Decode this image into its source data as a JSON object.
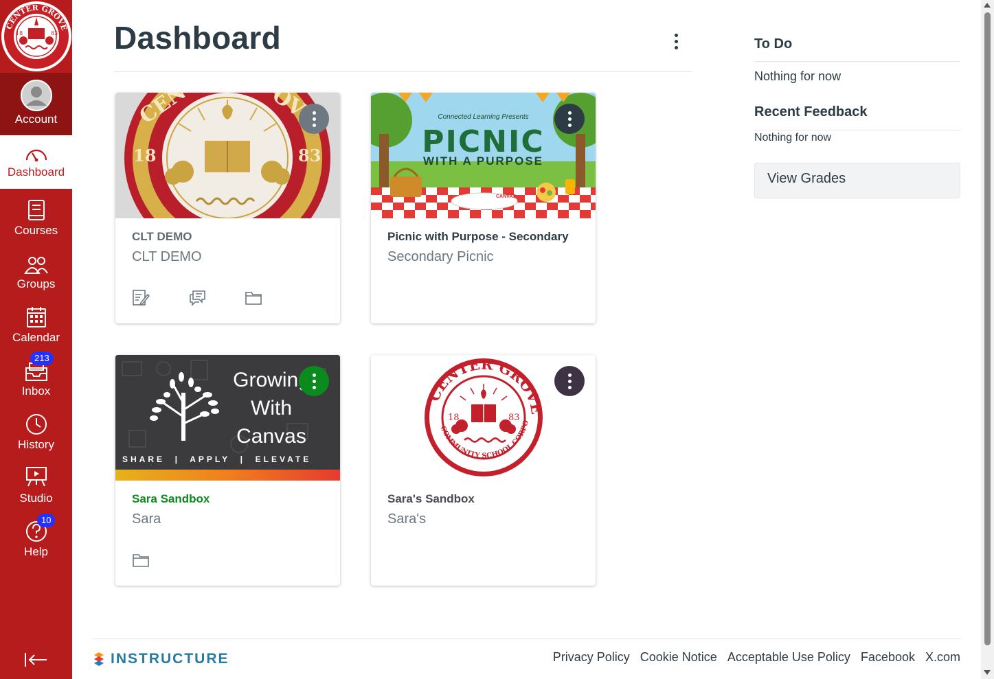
{
  "nav": {
    "logo_alt": "Center Grove Community School Corporation 1883",
    "items": [
      {
        "label": "Account",
        "icon": "user-avatar-icon"
      },
      {
        "label": "Dashboard",
        "icon": "dashboard-gauge-icon"
      },
      {
        "label": "Courses",
        "icon": "courses-book-icon"
      },
      {
        "label": "Groups",
        "icon": "groups-people-icon"
      },
      {
        "label": "Calendar",
        "icon": "calendar-icon"
      },
      {
        "label": "Inbox",
        "icon": "inbox-tray-icon",
        "badge": "213"
      },
      {
        "label": "History",
        "icon": "history-clock-icon"
      },
      {
        "label": "Studio",
        "icon": "studio-board-icon"
      },
      {
        "label": "Help",
        "icon": "help-question-icon",
        "badge": "10"
      }
    ],
    "collapse_icon": "collapse-arrow-icon"
  },
  "header": {
    "title": "Dashboard",
    "options_icon": "kebab-menu-icon"
  },
  "cards": [
    {
      "title": "CLT DEMO",
      "subtitle": "CLT DEMO",
      "title_color": "#5f6a72",
      "kebab_color": "#6d7883",
      "hero": "seal-gold",
      "icons": [
        "assignments-icon",
        "discussions-icon",
        "files-folder-icon"
      ]
    },
    {
      "title": "Picnic with Purpose - Secondary",
      "subtitle": "Secondary Picnic",
      "title_color": "#2d3b45",
      "kebab_color": "#2d3b45",
      "hero": "picnic",
      "hero_text": {
        "small": "Connected Learning Presents",
        "big": "PICNIC",
        "sub": "WITH A PURPOSE",
        "tag": "CANVAS"
      },
      "icons": []
    },
    {
      "title": "Sara Sandbox",
      "subtitle": "Sara",
      "title_color": "#0b8a1d",
      "kebab_color": "#0b8a1d",
      "hero": "growing",
      "hero_text": {
        "line1": "Growing",
        "line2": "With",
        "line3": "Canvas",
        "tagline": "SHARE  |  APPLY  |  ELEVATE"
      },
      "icons": [
        "files-folder-icon"
      ]
    },
    {
      "title": "Sara's Sandbox",
      "subtitle": "Sara's",
      "title_color": "#4a4a55",
      "kebab_color": "#3e3344",
      "hero": "seal-red",
      "icons": []
    }
  ],
  "sidebar": {
    "todo_title": "To Do",
    "todo_empty": "Nothing for now",
    "feedback_title": "Recent Feedback",
    "feedback_empty": "Nothing for now",
    "view_grades": "View Grades"
  },
  "footer": {
    "logo_text": "INSTRUCTURE",
    "links": [
      "Privacy Policy",
      "Cookie Notice",
      "Acceptable Use Policy",
      "Facebook",
      "X.com"
    ]
  },
  "colors": {
    "nav_bg": "#b71c1c",
    "badge": "#2630ff",
    "text": "#2d3b45"
  }
}
